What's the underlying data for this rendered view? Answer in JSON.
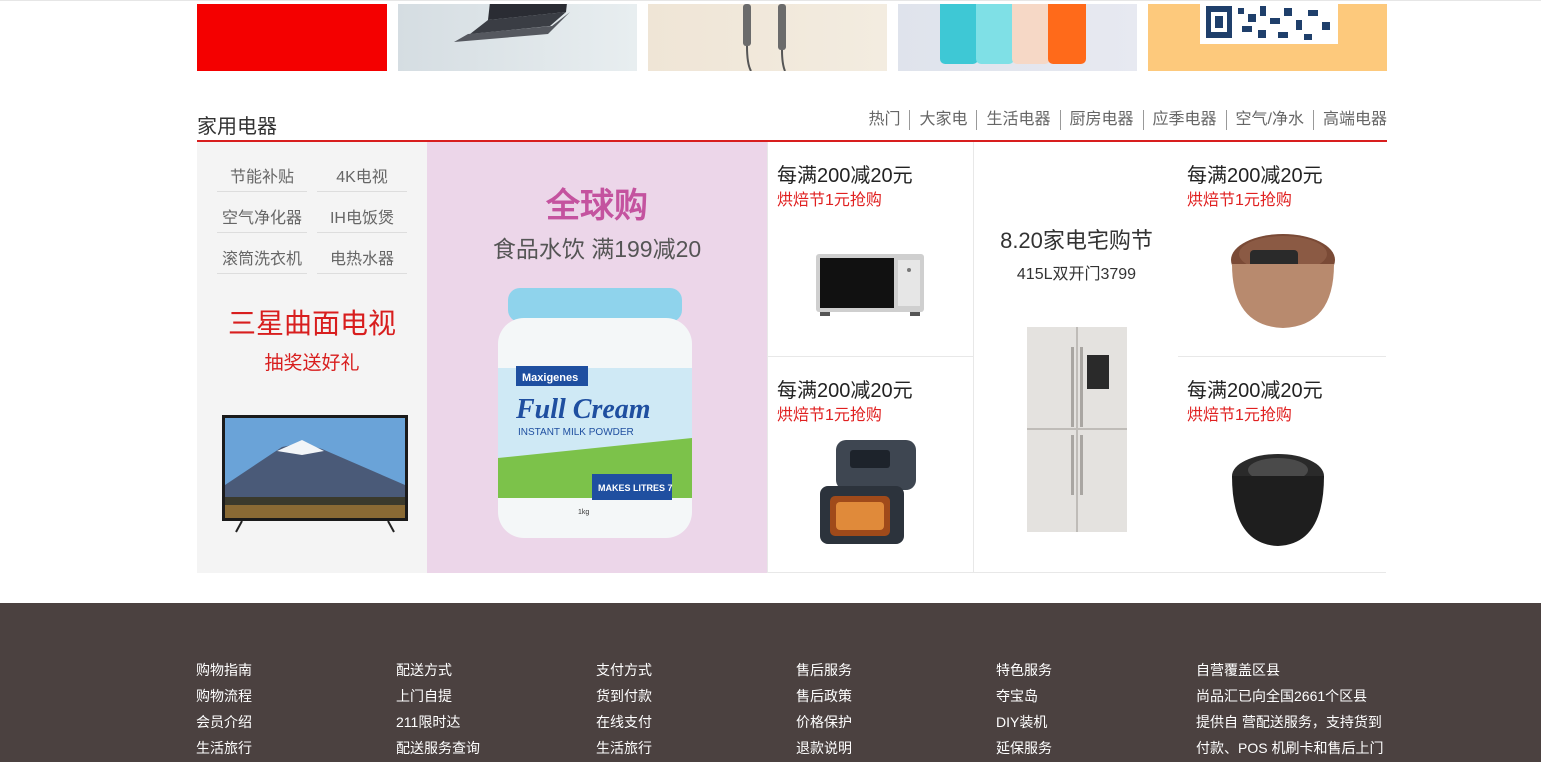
{
  "section": {
    "title": "家用电器",
    "tabs": [
      "热门",
      "大家电",
      "生活电器",
      "厨房电器",
      "应季电器",
      "空气/净水",
      "高端电器"
    ]
  },
  "left_panel": {
    "keywords": [
      "节能补贴",
      "4K电视",
      "空气净化器",
      "IH电饭煲",
      "滚筒洗衣机",
      "电热水器"
    ],
    "promo_title": "三星曲面电视",
    "promo_sub": "抽奖送好礼"
  },
  "feature_promo": {
    "title": "全球购",
    "subtitle": "食品水饮  满199减20",
    "product_brand": "Maxigenes",
    "product_name": "Full Cream",
    "product_desc": "INSTANT MILK POWDER",
    "product_badge": "MAKES LITRES 7",
    "product_weight": "1kg"
  },
  "products": [
    {
      "title": "每满200减20元",
      "sub": "烘焙节1元抢购",
      "icon": "microwave-oven"
    },
    {
      "title": "每满200减20元",
      "sub": "烘焙节1元抢购",
      "icon": "air-fryer"
    },
    {
      "title": "每满200减20元",
      "sub": "烘焙节1元抢购",
      "icon": "rice-cooker"
    },
    {
      "title": "每满200减20元",
      "sub": "烘焙节1元抢购",
      "icon": "pressure-cooker"
    }
  ],
  "fridge_promo": {
    "title": "8.20家电宅购节",
    "sub": "415L双开门3799",
    "icon": "refrigerator"
  },
  "footer": {
    "columns": [
      [
        "购物指南",
        "购物流程",
        "会员介绍",
        "生活旅行"
      ],
      [
        "配送方式",
        "上门自提",
        "211限时达",
        "配送服务查询"
      ],
      [
        "支付方式",
        "货到付款",
        "在线支付",
        "生活旅行"
      ],
      [
        "售后服务",
        "售后政策",
        "价格保护",
        "退款说明"
      ],
      [
        "特色服务",
        "夺宝岛",
        "DIY装机",
        "延保服务"
      ],
      [
        "自营覆盖区县",
        "尚品汇已向全国2661个区县",
        "提供自 营配送服务，支持货到",
        "付款、POS 机刷卡和售后上门"
      ]
    ]
  },
  "colors": {
    "accent_red": "#d81e1e",
    "footer_bg": "#4b4140",
    "pink_bg": "#ecd6e9"
  }
}
